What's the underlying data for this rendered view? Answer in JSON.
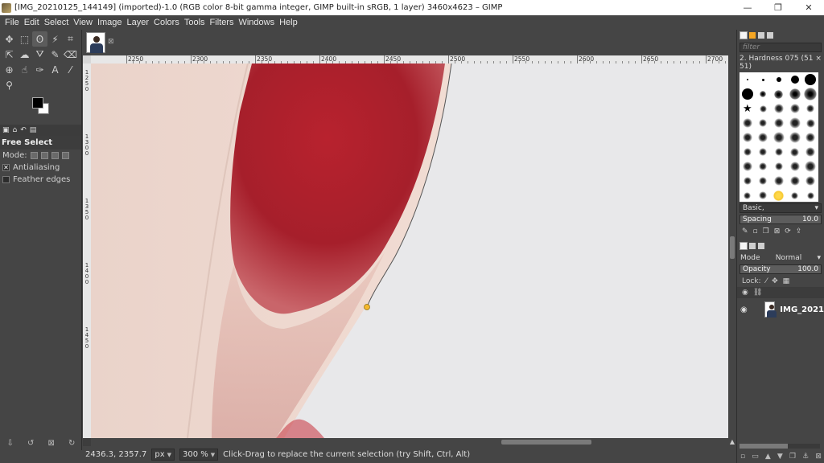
{
  "window": {
    "title": "[IMG_20210125_144149] (imported)-1.0 (RGB color 8-bit gamma integer, GIMP built-in sRGB, 1 layer) 3460x4623 – GIMP",
    "minimize": "—",
    "maximize": "❐",
    "close": "✕"
  },
  "menu": [
    "File",
    "Edit",
    "Select",
    "View",
    "Image",
    "Layer",
    "Colors",
    "Tools",
    "Filters",
    "Windows",
    "Help"
  ],
  "toolbox": {
    "tools": [
      {
        "name": "move-tool-icon",
        "glyph": "✥"
      },
      {
        "name": "rect-select-tool-icon",
        "glyph": "⬚"
      },
      {
        "name": "free-select-tool-icon",
        "glyph": "ʘ",
        "active": true
      },
      {
        "name": "fuzzy-select-tool-icon",
        "glyph": "⚡"
      },
      {
        "name": "crop-tool-icon",
        "glyph": "⌗"
      },
      {
        "name": "unified-transform-tool-icon",
        "glyph": "⇱"
      },
      {
        "name": "warp-tool-icon",
        "glyph": "☁"
      },
      {
        "name": "bucket-fill-tool-icon",
        "glyph": "⛛"
      },
      {
        "name": "paintbrush-tool-icon",
        "glyph": "✎"
      },
      {
        "name": "eraser-tool-icon",
        "glyph": "⌫"
      },
      {
        "name": "clone-tool-icon",
        "glyph": "⊕"
      },
      {
        "name": "smudge-tool-icon",
        "glyph": "☝"
      },
      {
        "name": "path-tool-icon",
        "glyph": "✑"
      },
      {
        "name": "text-tool-icon",
        "glyph": "A"
      },
      {
        "name": "color-picker-tool-icon",
        "glyph": "⁄"
      },
      {
        "name": "zoom-tool-icon",
        "glyph": "⚲"
      }
    ],
    "fg_color": "#000000",
    "bg_color": "#ffffff",
    "options_title": "Free Select",
    "mode_label": "Mode:",
    "antialiasing_label": "Antialiasing",
    "antialiasing_checked": true,
    "feather_label": "Feather edges",
    "feather_checked": false
  },
  "ruler": {
    "h_labels": [
      "2250",
      "2300",
      "2350",
      "2400",
      "2450",
      "2500",
      "2550",
      "2600",
      "2650",
      "2700"
    ],
    "v_labels": [
      "1250",
      "1300",
      "1350",
      "1400",
      "1450"
    ]
  },
  "statusbar": {
    "coords": "2436.3, 2357.7",
    "unit": "px",
    "zoom": "300 %",
    "message": "Click-Drag to replace the current selection (try Shift, Ctrl, Alt)"
  },
  "dock": {
    "filter_placeholder": "filter",
    "brush_name": "2. Hardness 075 (51 × 51)",
    "brush_preset": "Basic,",
    "spacing_label": "Spacing",
    "spacing_value": "10.0",
    "layers_mode_label": "Mode",
    "layers_mode_value": "Normal",
    "opacity_label": "Opacity",
    "opacity_value": "100.0",
    "lock_label": "Lock:",
    "layer_name": "IMG_2021"
  },
  "colors": {
    "canvas_bg": "#e8e8ea",
    "skin": "#eed6cd",
    "nail_red": "#a8202c",
    "anchor_point": "#f5b82e"
  }
}
